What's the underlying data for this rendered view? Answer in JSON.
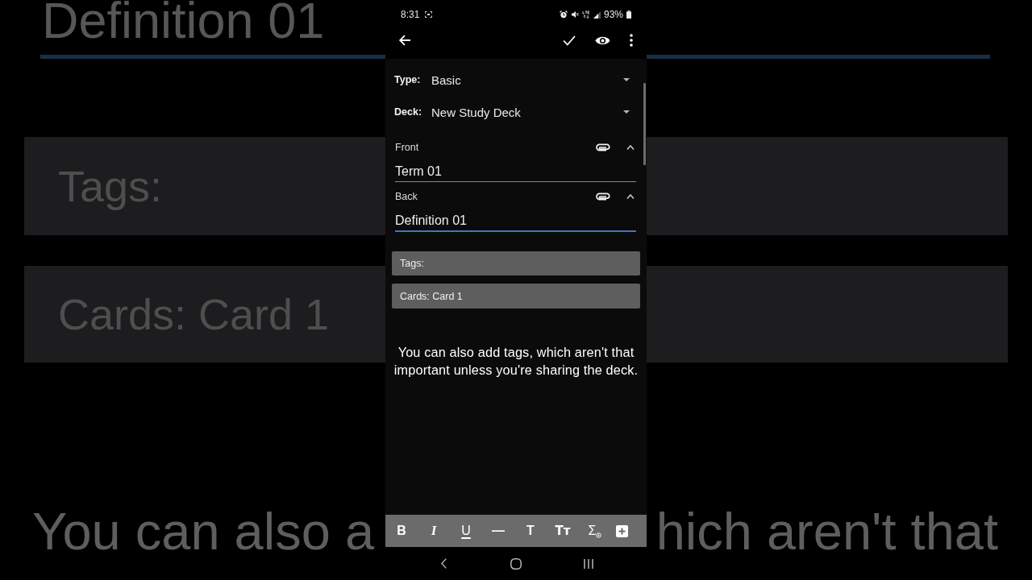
{
  "backdrop": {
    "field_value": "Definition 01",
    "tags_label": "Tags:",
    "cards_label": "Cards: Card 1",
    "caption_left": "You can also a",
    "caption_right": "hich aren't that"
  },
  "status_bar": {
    "time": "8:31",
    "battery": "93%"
  },
  "editor": {
    "type": {
      "label": "Type:",
      "value": "Basic"
    },
    "deck": {
      "label": "Deck:",
      "value": "New Study Deck"
    },
    "fields": [
      {
        "label": "Front",
        "value": "Term 01",
        "expanded": true,
        "focused": false
      },
      {
        "label": "Back",
        "value": "Definition 01",
        "expanded": true,
        "focused": true
      }
    ],
    "tags_button": "Tags:",
    "cards_button": "Cards: Card 1"
  },
  "caption": {
    "lines": [
      "You can also add tags, which aren't that",
      "important unless you're sharing the deck."
    ]
  },
  "format_toolbar": [
    {
      "kind": "bold",
      "glyph": "B"
    },
    {
      "kind": "italic",
      "glyph": "I"
    },
    {
      "kind": "underline",
      "glyph": "U"
    },
    {
      "kind": "rule",
      "glyph": "—"
    },
    {
      "kind": "title",
      "glyph": "T"
    },
    {
      "kind": "size",
      "glyph": "Tᴛ"
    },
    {
      "kind": "math",
      "glyph": "Σ"
    },
    {
      "kind": "insert"
    }
  ]
}
